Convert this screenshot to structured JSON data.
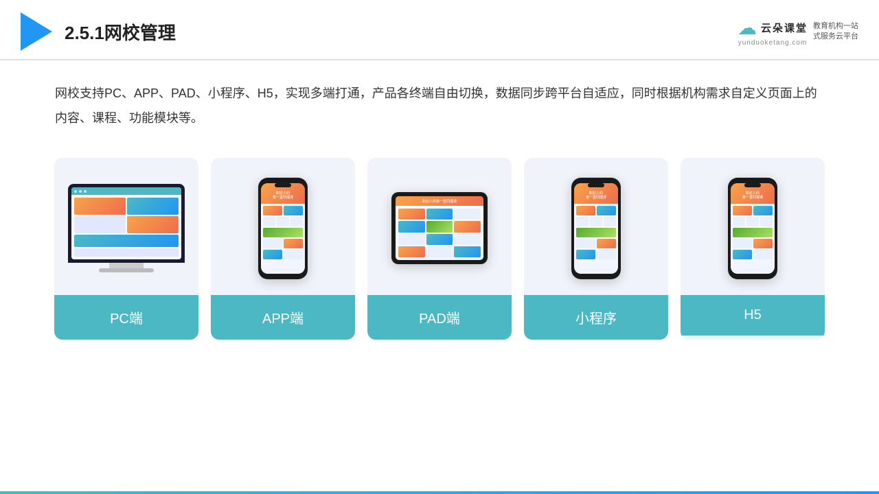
{
  "header": {
    "title": "2.5.1网校管理",
    "brand": {
      "name": "云朵课堂",
      "url": "yunduoketang.com",
      "slogan": "教育机构一站\n式服务云平台"
    }
  },
  "description": {
    "text": "网校支持PC、APP、PAD、小程序、H5，实现多端打通，产品各终端自由切换，数据同步跨平台自适应，同时根据机构需求自定义页面上的内容、课程、功能模块等。"
  },
  "cards": [
    {
      "id": "pc",
      "label": "PC端",
      "type": "pc"
    },
    {
      "id": "app",
      "label": "APP端",
      "type": "phone"
    },
    {
      "id": "pad",
      "label": "PAD端",
      "type": "tablet"
    },
    {
      "id": "miniprogram",
      "label": "小程序",
      "type": "phone"
    },
    {
      "id": "h5",
      "label": "H5",
      "type": "phone"
    }
  ],
  "colors": {
    "teal": "#4cb8c4",
    "blue": "#2196f3",
    "accent": "#f7a44a"
  }
}
